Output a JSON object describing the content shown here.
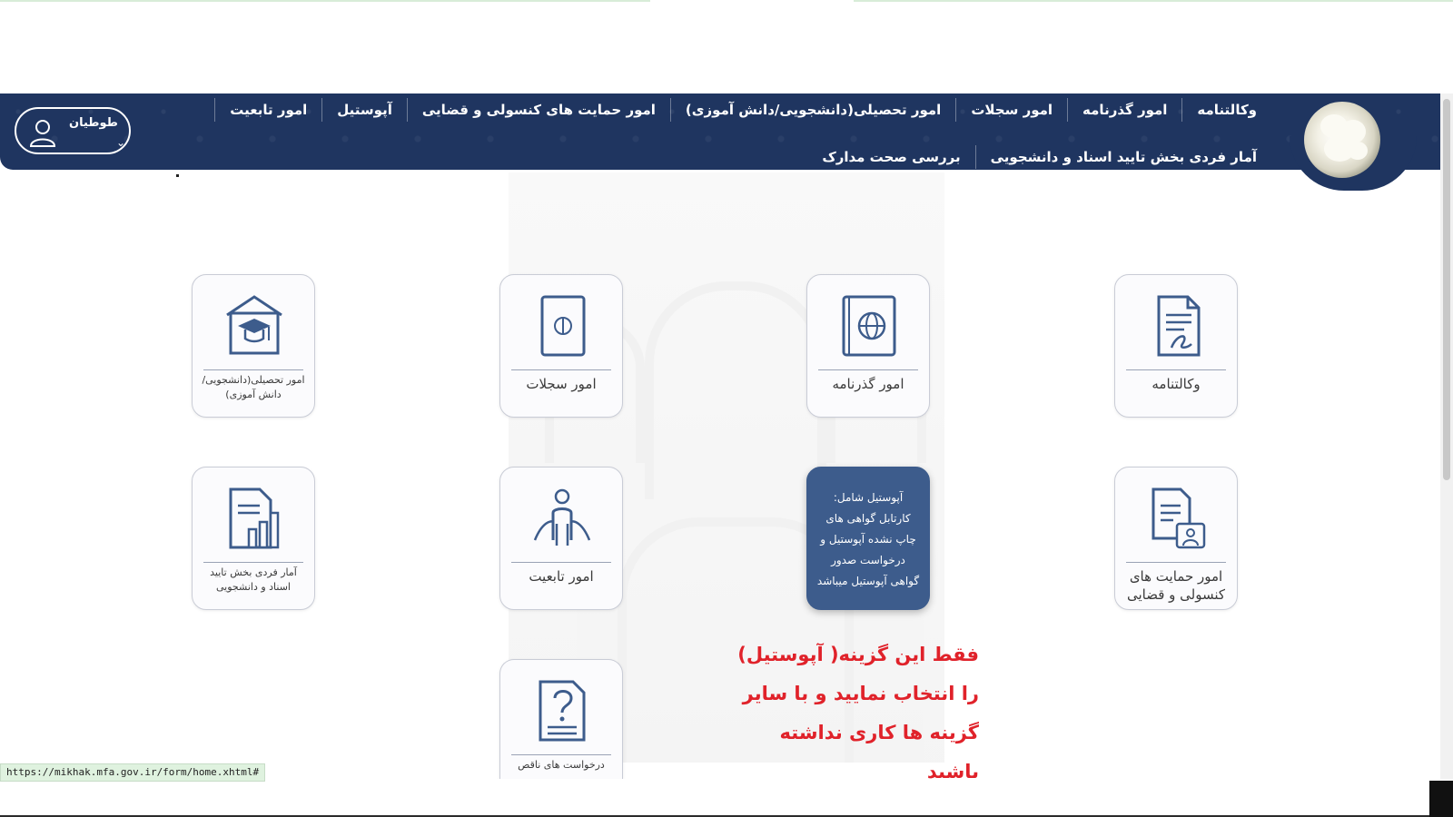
{
  "header": {
    "nav_row1": [
      "وکالتنامه",
      "امور گذرنامه",
      "امور سجلات",
      "امور تحصیلی(دانشجویی/دانش آموزی)",
      "امور حمایت های کنسولی و قضایی",
      "آپوستیل",
      "امور تابعیت"
    ],
    "nav_row2": [
      "آمار فردی بخش تایید اسناد و دانشجویی",
      "بررسی صحت مدارک"
    ],
    "user_name": "طوطیان"
  },
  "tiles": [
    {
      "label": "وکالتنامه",
      "icon": "document-signature-icon"
    },
    {
      "label": "امور گذرنامه",
      "icon": "passport-globe-icon"
    },
    {
      "label": "امور سجلات",
      "icon": "registry-book-icon"
    },
    {
      "label": "امور تحصیلی(دانشجویی/دانش آموزی)",
      "icon": "graduation-cap-icon"
    },
    {
      "label": "امور حمایت های کنسولی و قضایی",
      "icon": "document-person-icon"
    },
    {
      "label": "آپوستیل شامل: کارتابل گواهی های چاپ نشده آپوستیل و درخواست صدور گواهی آپوستیل میباشد",
      "icon": "apostille-icon"
    },
    {
      "label": "امور تابعیت",
      "icon": "citizen-person-icon"
    },
    {
      "label": "آمار فردی بخش تایید اسناد و دانشجویی",
      "icon": "report-chart-icon"
    },
    {
      "label": "درخواست های ناقص",
      "icon": "question-document-icon"
    }
  ],
  "note": "فقط این گزینه( آپوستیل) را انتخاب نمایید و با سایر گزینه ها کاری نداشته باشید",
  "status_url": "https://mikhak.mfa.gov.ir/form/home.xhtml#",
  "colors": {
    "header": "#1f3560",
    "tile_active": "#3d5c8c",
    "note": "#e0222a"
  }
}
